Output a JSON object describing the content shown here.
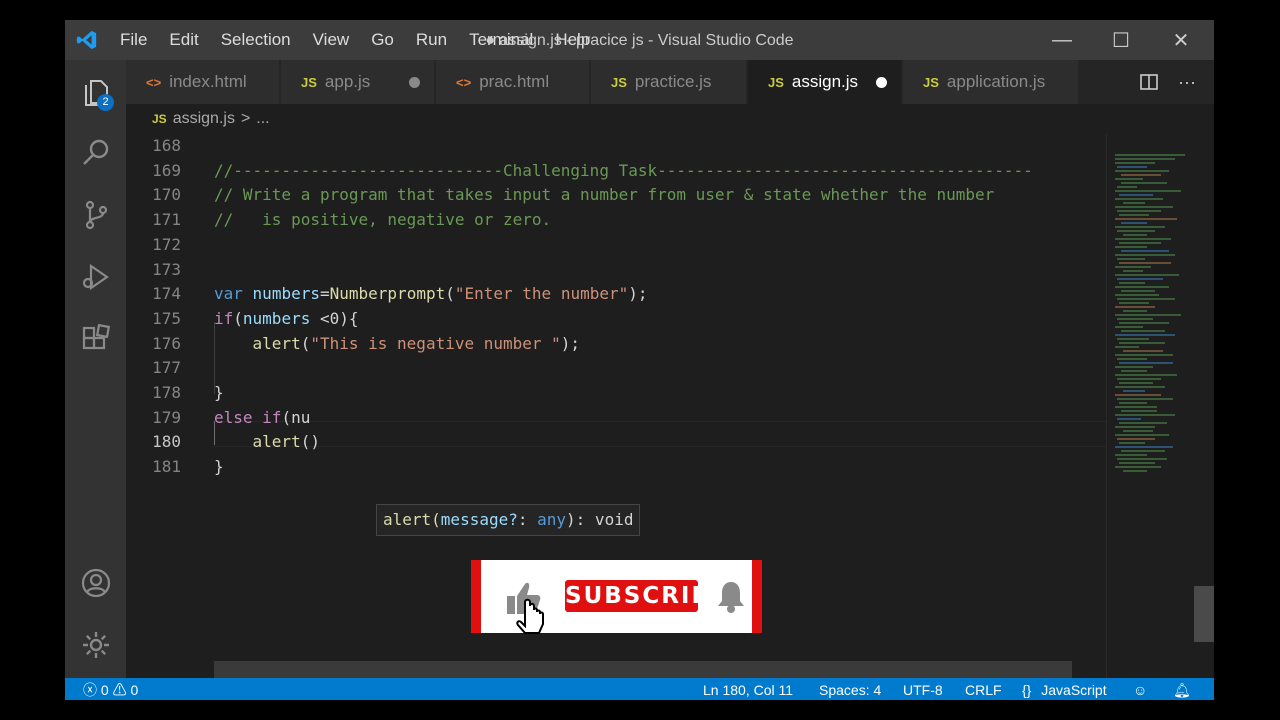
{
  "window": {
    "title": "● assign.js - pracice js - Visual Studio Code",
    "controls": {
      "minimize": "—",
      "maximize": "☐",
      "close": "✕"
    }
  },
  "menu": [
    "File",
    "Edit",
    "Selection",
    "View",
    "Go",
    "Run",
    "Terminal",
    "Help"
  ],
  "activity": {
    "explorer_badge": "2"
  },
  "tabs": [
    {
      "label": "index.html",
      "icon": "<>",
      "kind": "html",
      "dirty": false,
      "active": false
    },
    {
      "label": "app.js",
      "icon": "JS",
      "kind": "js",
      "dirty": true,
      "active": false
    },
    {
      "label": "prac.html",
      "icon": "<>",
      "kind": "html",
      "dirty": false,
      "active": false
    },
    {
      "label": "practice.js",
      "icon": "JS",
      "kind": "js",
      "dirty": false,
      "active": false
    },
    {
      "label": "assign.js",
      "icon": "JS",
      "kind": "js",
      "dirty": true,
      "active": true
    },
    {
      "label": "application.js",
      "icon": "JS",
      "kind": "js",
      "dirty": false,
      "active": false
    }
  ],
  "breadcrumb": {
    "icon": "JS",
    "file": "assign.js",
    "separator": ">",
    "rest": "..."
  },
  "editor": {
    "current_line": 180,
    "lines": [
      {
        "n": "168",
        "text": ""
      },
      {
        "n": "169",
        "text": "//----------------------------Challenging Task---------------------------------------"
      },
      {
        "n": "170",
        "text": "// Write a program that takes input a number from user & state whether the number"
      },
      {
        "n": "171",
        "text": "//   is positive, negative or zero."
      },
      {
        "n": "172",
        "text": ""
      },
      {
        "n": "173",
        "text": ""
      },
      {
        "n": "174",
        "text": "var numbers=Numberprompt(\"Enter the number\");"
      },
      {
        "n": "175",
        "text": "if(numbers <0){"
      },
      {
        "n": "176",
        "text": "    alert(\"This is negative number \");"
      },
      {
        "n": "177",
        "text": ""
      },
      {
        "n": "178",
        "text": "}"
      },
      {
        "n": "179",
        "text": "else if(nu"
      },
      {
        "n": "180",
        "text": "    alert()"
      },
      {
        "n": "181",
        "text": "}"
      }
    ],
    "hover": {
      "fn": "alert(",
      "param": "message?",
      "colon": ": ",
      "type": "any",
      "rest": "): void"
    }
  },
  "subscribe": {
    "label": "SUBSCRIBE",
    "like_icon": "thumbs-up-icon",
    "bell_icon": "bell-icon"
  },
  "status": {
    "errors": "0",
    "warnings": "0",
    "position": "Ln 180, Col 11",
    "spaces": "Spaces: 4",
    "encoding": "UTF-8",
    "eol": "CRLF",
    "language": "JavaScript",
    "language_icon": "{}"
  },
  "colors": {
    "statusbar": "#007acc",
    "activity": "#333333",
    "subscribe": "#e01010"
  }
}
